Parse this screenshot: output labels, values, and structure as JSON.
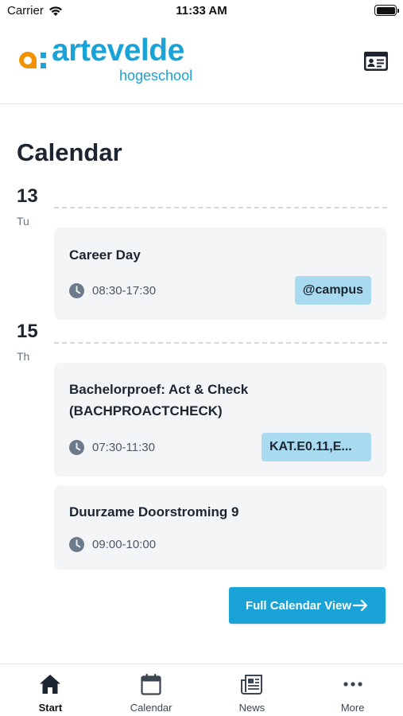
{
  "status_bar": {
    "carrier": "Carrier",
    "time": "11:33 AM"
  },
  "header": {
    "logo_prefix": "a:",
    "logo_word": "artevelde",
    "logo_sub": "hogeschool",
    "brand_orange": "#f39200",
    "brand_blue": "#1aa3d6",
    "id_card_icon": "id-card-icon"
  },
  "page": {
    "title": "Calendar"
  },
  "days": [
    {
      "num": "13",
      "name": "Tu",
      "events": [
        {
          "title": "Career Day",
          "time": "08:30-17:30",
          "location": "@campus"
        }
      ]
    },
    {
      "num": "15",
      "name": "Th",
      "events": [
        {
          "title": "Bachelorproef: Act & Check (BACHPROACTCHECK)",
          "time": "07:30-11:30",
          "location": "KAT.E0.11,E..."
        },
        {
          "title": "Duurzame Doorstroming 9",
          "time": "09:00-10:00",
          "location": ""
        }
      ]
    }
  ],
  "full_calendar_button": "Full Calendar View",
  "tabs": [
    {
      "label": "Start",
      "icon": "home-icon",
      "active": true
    },
    {
      "label": "Calendar",
      "icon": "calendar-icon",
      "active": false
    },
    {
      "label": "News",
      "icon": "newspaper-icon",
      "active": false
    },
    {
      "label": "More",
      "icon": "more-icon",
      "active": false
    }
  ]
}
